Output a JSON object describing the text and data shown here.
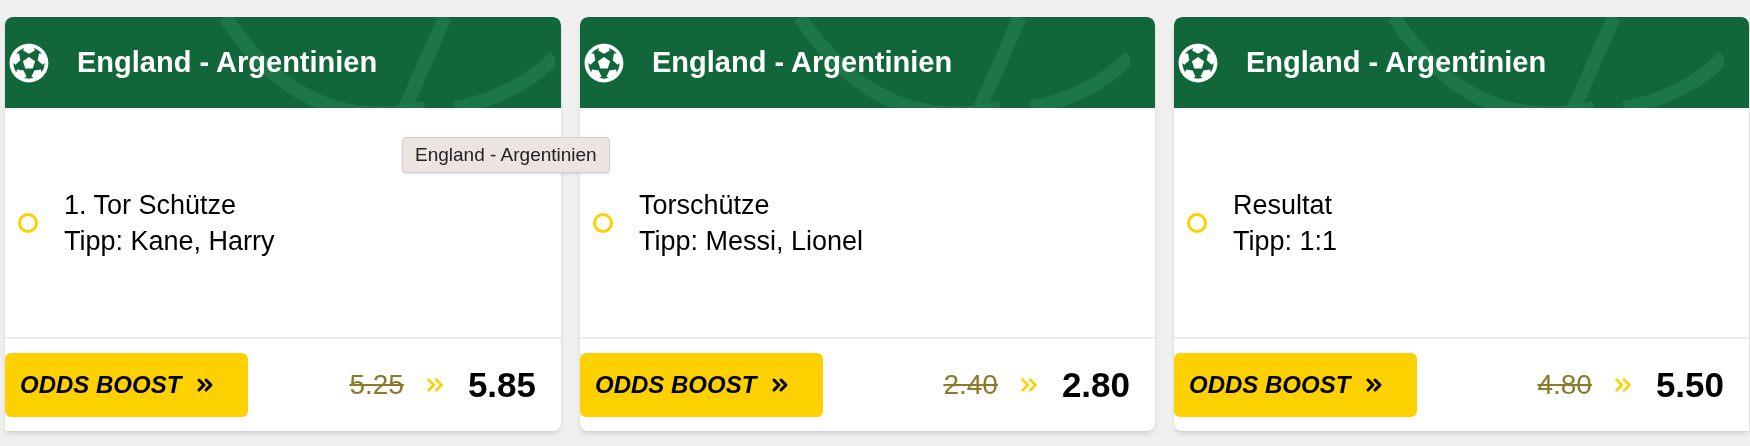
{
  "cards": [
    {
      "title": "England - Argentinien",
      "market": "1. Tor Schütze",
      "tip": "Tipp: Kane, Harry",
      "selected": false,
      "boost_label": "ODDS BOOST",
      "old_odds": "5.25",
      "new_odds": "5.85"
    },
    {
      "title": "England - Argentinien",
      "market": "Torschütze",
      "tip": "Tipp: Messi, Lionel",
      "selected": false,
      "boost_label": "ODDS BOOST",
      "old_odds": "2.40",
      "new_odds": "2.80"
    },
    {
      "title": "England - Argentinien",
      "market": "Resultat",
      "tip": "Tipp: 1:1",
      "selected": false,
      "boost_label": "ODDS BOOST",
      "old_odds": "4.80",
      "new_odds": "5.50"
    }
  ],
  "tooltip": {
    "text": "England - Argentinien"
  }
}
